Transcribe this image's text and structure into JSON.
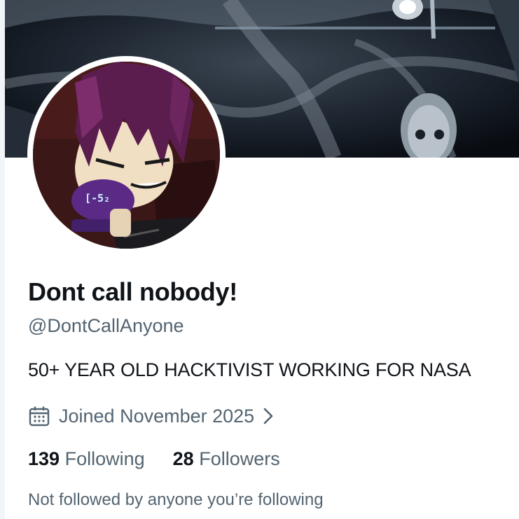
{
  "profile": {
    "display_name": "Dont call nobody!",
    "handle": "@DontCallAnyone",
    "bio": "50+ YEAR OLD HACKTIVIST WORKING FOR NASA",
    "joined": "Joined November 2025",
    "following_count": "139",
    "following_label": "Following",
    "followers_count": "28",
    "followers_label": "Followers",
    "followed_by_note": "Not followed by anyone you’re following",
    "avatar_device_text": "[-5₂"
  },
  "icons": {
    "joined": "calendar-icon",
    "joined_more": "chevron-right-icon"
  },
  "colors": {
    "primary_text": "#0f1419",
    "secondary_text": "#536471",
    "avatar_purple": "#5a2a86"
  }
}
